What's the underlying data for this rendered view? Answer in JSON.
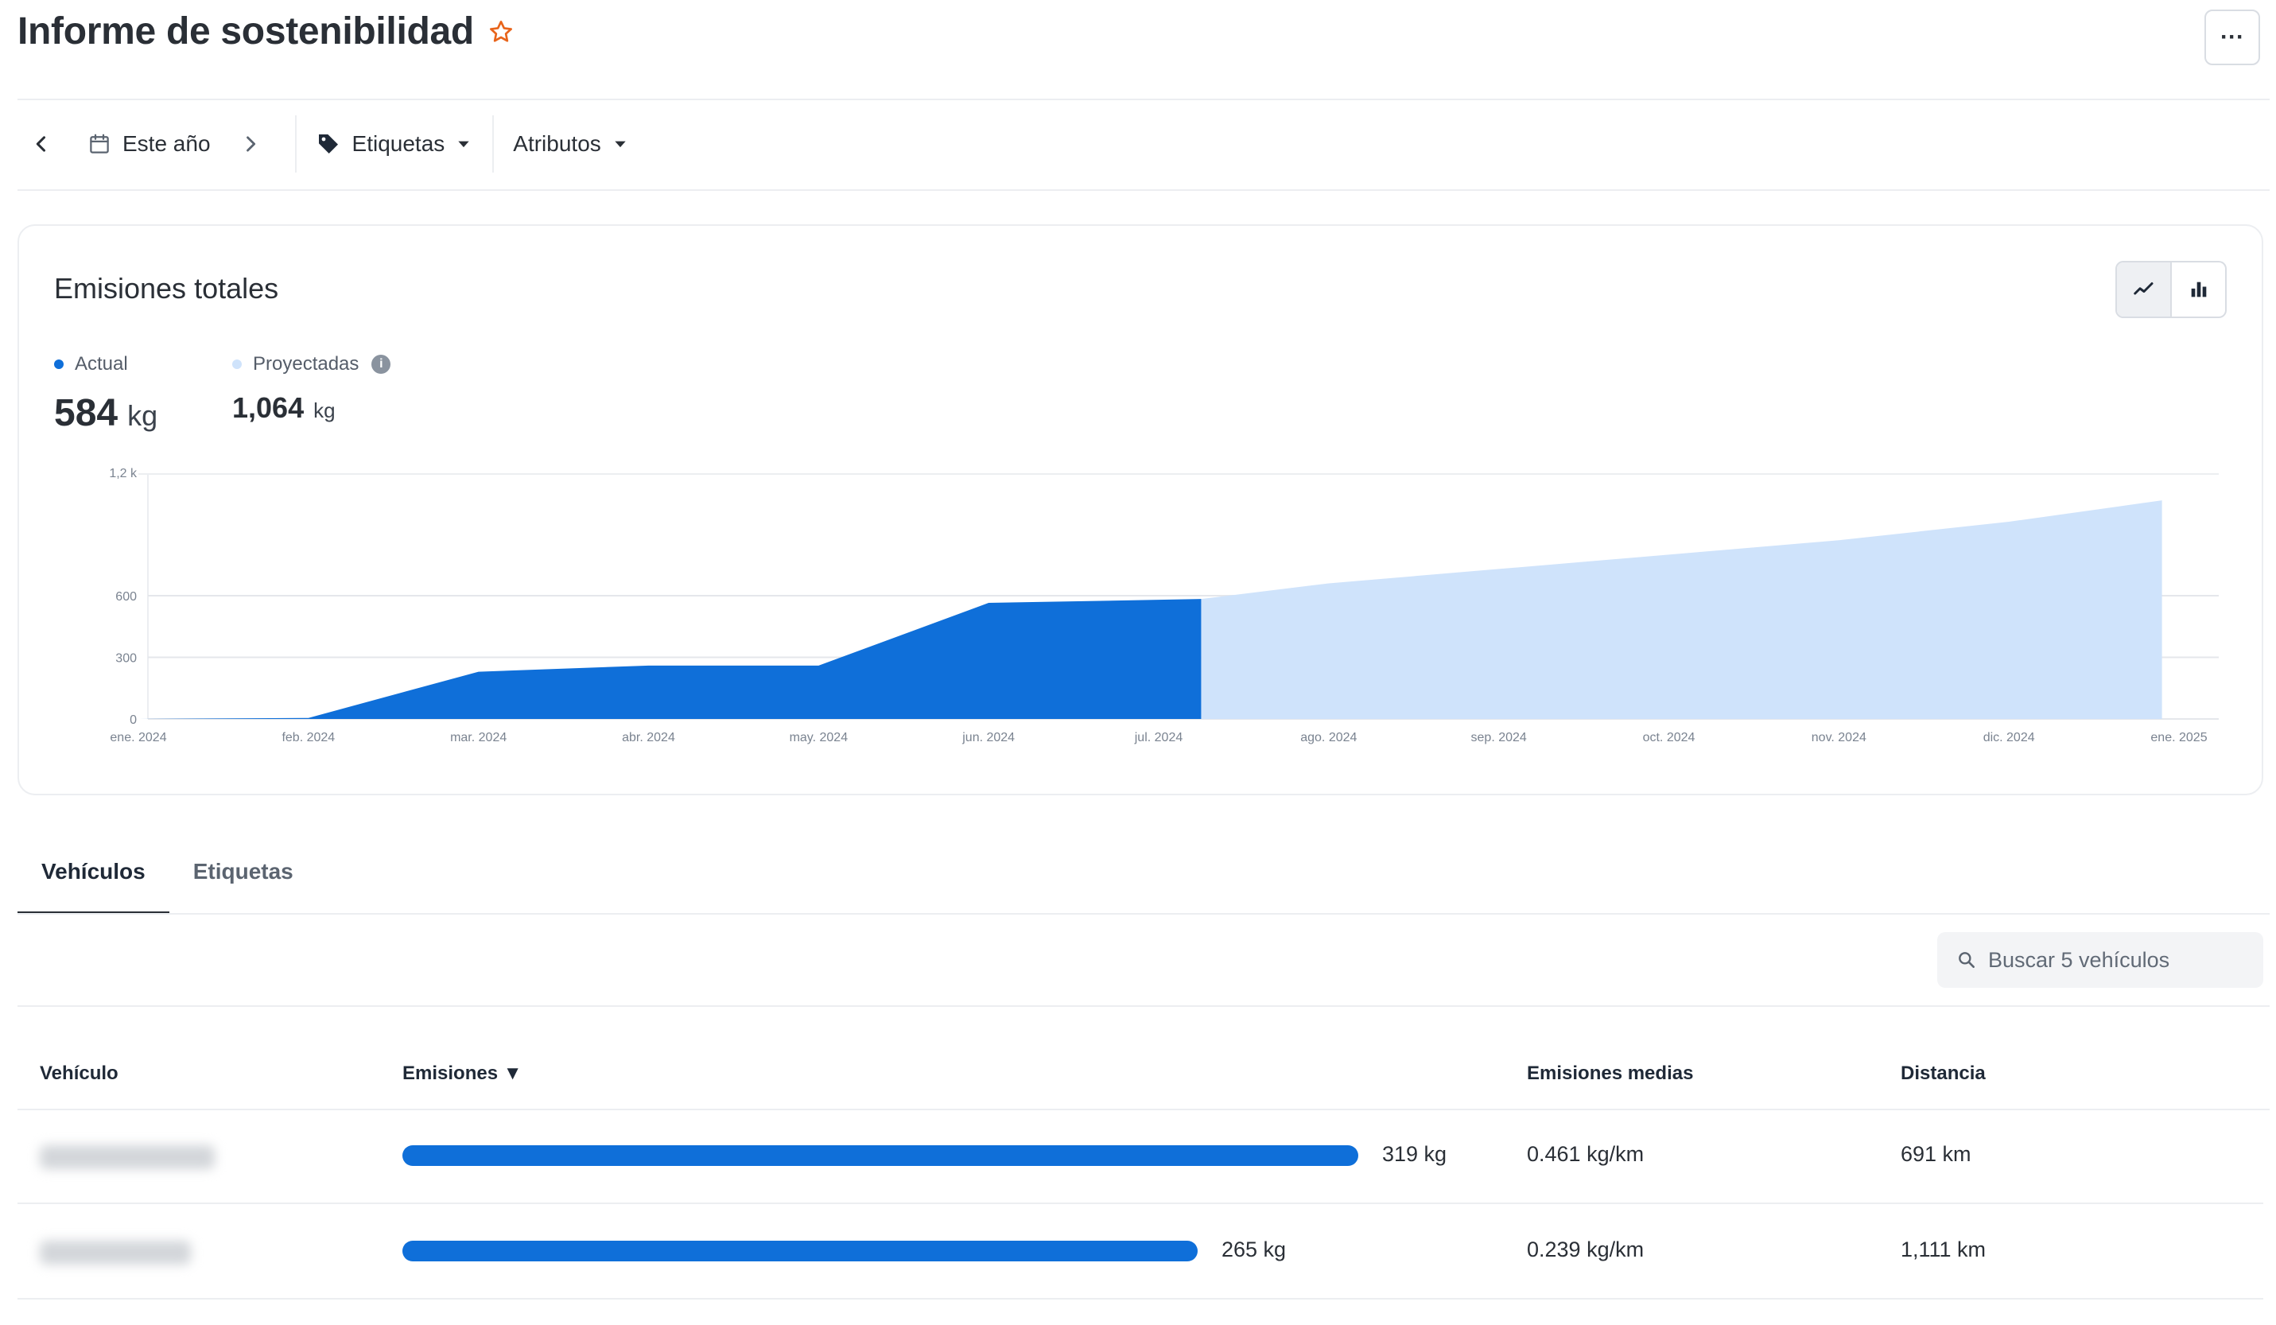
{
  "header": {
    "title": "Informe de sostenibilidad",
    "more_label": "···"
  },
  "filters": {
    "period_label": "Este año",
    "tags_label": "Etiquetas",
    "attributes_label": "Atributos"
  },
  "chart_card": {
    "title": "Emisiones totales",
    "legend": {
      "actual": {
        "label": "Actual",
        "value": "584",
        "unit": "kg",
        "color": "#0f6fd9"
      },
      "projected": {
        "label": "Proyectadas",
        "value": "1,064",
        "unit": "kg",
        "color": "#cfe3fb"
      }
    }
  },
  "chart_data": {
    "type": "area",
    "x": [
      "ene. 2024",
      "feb. 2024",
      "mar. 2024",
      "abr. 2024",
      "may. 2024",
      "jun. 2024",
      "jul. 2024",
      "ago. 2024",
      "sep. 2024",
      "oct. 2024",
      "nov. 2024",
      "dic. 2024",
      "ene. 2025"
    ],
    "y_ticks": [
      {
        "value": 0,
        "label": "0"
      },
      {
        "value": 300,
        "label": "300"
      },
      {
        "value": 600,
        "label": "600"
      },
      {
        "value": 1200,
        "label": "1,2 k"
      }
    ],
    "ylim": [
      0,
      1200
    ],
    "series": [
      {
        "name": "Actual",
        "color": "#0f6fd9",
        "points": [
          [
            0,
            0
          ],
          [
            1,
            5
          ],
          [
            2,
            230
          ],
          [
            3,
            260
          ],
          [
            4,
            260
          ],
          [
            5,
            565
          ],
          [
            6.25,
            584
          ]
        ]
      },
      {
        "name": "Proyectadas",
        "color": "#cfe3fb",
        "points": [
          [
            6.25,
            584
          ],
          [
            7,
            660
          ],
          [
            8,
            730
          ],
          [
            9,
            800
          ],
          [
            10,
            870
          ],
          [
            11,
            960
          ],
          [
            11.9,
            1064
          ]
        ]
      }
    ],
    "grid": true
  },
  "tabs": [
    {
      "label": "Vehículos",
      "active": true
    },
    {
      "label": "Etiquetas",
      "active": false
    }
  ],
  "search": {
    "placeholder": "Buscar 5 vehículos"
  },
  "table": {
    "headers": {
      "vehicle": "Vehículo",
      "emissions": "Emisiones ▼",
      "avg": "Emisiones medias",
      "distance": "Distancia"
    },
    "rows": [
      {
        "emissions": "319 kg",
        "emissions_value": 319,
        "avg": "0.461 kg/km",
        "distance": "691 km"
      },
      {
        "emissions": "265 kg",
        "emissions_value": 265,
        "avg": "0.239 kg/km",
        "distance": "1,111 km"
      }
    ]
  }
}
